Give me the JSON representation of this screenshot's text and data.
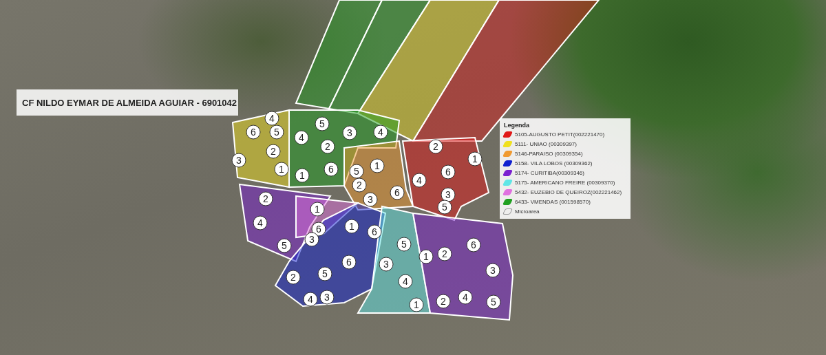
{
  "title_label": "CF NILDO EYMAR DE ALMEIDA AGUIAR - 6901042",
  "legend": {
    "title": "Legenda",
    "items": [
      {
        "kind": "team",
        "label": "5105-AUGUSTO PETIT(002221470)",
        "color": "#e01818"
      },
      {
        "kind": "team",
        "label": "5111- UNIAO (00309397)",
        "color": "#f0e020"
      },
      {
        "kind": "team",
        "label": "5146-PARAISO (00309354)",
        "color": "#f09a30"
      },
      {
        "kind": "team",
        "label": "5158- VILA LOBOS (00309362)",
        "color": "#1020d0"
      },
      {
        "kind": "team",
        "label": "5174- CURITIBA(00309346)",
        "color": "#7a20d0"
      },
      {
        "kind": "team",
        "label": "5175- AMERICANO FREIRE (00309370)",
        "color": "#60e6e6"
      },
      {
        "kind": "team",
        "label": "5432- EUZEBIO DE QUEIROZ(002221462)",
        "color": "#e070e0"
      },
      {
        "kind": "team",
        "label": "6433- VMENDAS (001598570)",
        "color": "#20a020"
      },
      {
        "kind": "outline",
        "label": "Microarea"
      }
    ]
  },
  "microarea_labels": [
    "4",
    "6",
    "5",
    "2",
    "3",
    "1",
    "4",
    "1",
    "5",
    "3",
    "2",
    "6",
    "4",
    "5",
    "1",
    "2",
    "3",
    "6",
    "4",
    "2",
    "6",
    "1",
    "3",
    "5",
    "2",
    "4",
    "5",
    "1",
    "6",
    "3",
    "1",
    "6",
    "5",
    "2",
    "4",
    "3",
    "6",
    "5",
    "3",
    "4",
    "1",
    "2",
    "1",
    "2",
    "6",
    "3",
    "4",
    "5"
  ]
}
